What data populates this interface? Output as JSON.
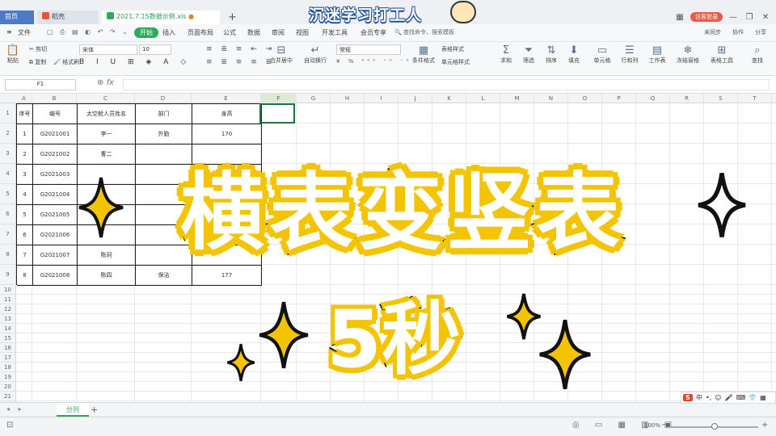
{
  "tabs": {
    "home": "首页",
    "doc": "稻壳",
    "sheet": "2021.7.15数据示例.xls",
    "new_tab": "+"
  },
  "banner_text": "沉迷学习打工人",
  "titlebar_right": {
    "login": "访客登录"
  },
  "menu": {
    "file": "文件",
    "items": [
      "开始",
      "插入",
      "页面布局",
      "公式",
      "数据",
      "审阅",
      "视图",
      "开发工具",
      "会员专享"
    ],
    "active": "开始",
    "search": "查找命令、搜索模板",
    "right": [
      "未同步",
      "协作",
      "分享"
    ]
  },
  "ribbon": {
    "paste": "粘贴",
    "cut": "剪切",
    "copy": "复制",
    "format_painter": "格式刷",
    "font_name": "宋体",
    "font_size": "10",
    "merge_center": "合并居中",
    "wrap": "自动换行",
    "number_format": "常规",
    "conditional": "条件格式",
    "table_style": "表格样式",
    "cell_style": "单元格样式",
    "sum": "求和",
    "filter": "筛选",
    "sort": "排序",
    "fill": "填充",
    "cells": "单元格",
    "rows_cols": "行和列",
    "worksheet": "工作表",
    "freeze": "冻结窗格",
    "table_tools": "表格工具",
    "find": "查找"
  },
  "formula_bar": {
    "name_box": "F1",
    "fx": "fx",
    "formula": ""
  },
  "columns": [
    "A",
    "B",
    "C",
    "D",
    "E",
    "F",
    "G",
    "H",
    "I",
    "J",
    "K",
    "L",
    "M",
    "N",
    "O",
    "P",
    "Q",
    "R",
    "S",
    "T"
  ],
  "selected_column": "F",
  "rows": [
    "1",
    "2",
    "3",
    "4",
    "5",
    "6",
    "7",
    "8",
    "9",
    "10",
    "11",
    "12",
    "13",
    "14",
    "15",
    "16",
    "17",
    "18",
    "19",
    "20",
    "21",
    "22",
    "23"
  ],
  "table": {
    "headers": [
      "序号",
      "编号",
      "太空舱人员姓名",
      "部门",
      "身高"
    ],
    "data": [
      [
        "1",
        "G2021001",
        "李一",
        "外勤",
        "170"
      ],
      [
        "2",
        "G2021002",
        "曹二",
        "",
        ""
      ],
      [
        "3",
        "G2021003",
        "",
        "",
        ""
      ],
      [
        "4",
        "G2021004",
        "",
        "",
        ""
      ],
      [
        "5",
        "G2021005",
        "",
        "",
        ""
      ],
      [
        "6",
        "G2021006",
        "",
        "",
        ""
      ],
      [
        "7",
        "G2021007",
        "陈珂",
        "",
        ""
      ],
      [
        "8",
        "G2021008",
        "陈四",
        "保洁",
        "177"
      ]
    ]
  },
  "sheet_tab": "分列",
  "status": {
    "zoom": "100%"
  },
  "ime": "中",
  "overlay": {
    "title": "横表变竖表",
    "subtitle": "5秒"
  },
  "colors": {
    "accent_green": "#2eaa5c",
    "home_tab_blue": "#4b7ac7",
    "overlay_outline_yellow": "#f5c400"
  }
}
